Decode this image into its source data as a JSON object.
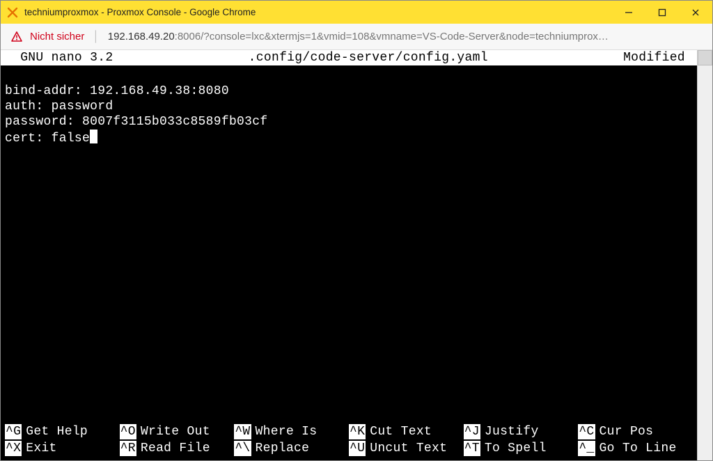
{
  "window": {
    "title": "techniumproxmox - Proxmox Console - Google Chrome"
  },
  "addrbar": {
    "not_secure_label": "Nicht sicher",
    "url_host": "192.168.49.20",
    "url_port": ":8006",
    "url_query": "/?console=lxc&xtermjs=1&vmid=108&vmname=VS-Code-Server&node=techniumprox…"
  },
  "nano": {
    "version": "  GNU nano 3.2",
    "filepath": ".config/code-server/config.yaml",
    "status": "Modified "
  },
  "file_lines": [
    "",
    "bind-addr: 192.168.49.38:8080",
    "auth: password",
    "password: 8007f3115b033c8589fb03cf",
    "cert: false"
  ],
  "shortcuts": [
    {
      "key": "^G",
      "label": "Get Help"
    },
    {
      "key": "^O",
      "label": "Write Out"
    },
    {
      "key": "^W",
      "label": "Where Is"
    },
    {
      "key": "^K",
      "label": "Cut Text"
    },
    {
      "key": "^J",
      "label": "Justify"
    },
    {
      "key": "^C",
      "label": "Cur Pos"
    },
    {
      "key": "^X",
      "label": "Exit"
    },
    {
      "key": "^R",
      "label": "Read File"
    },
    {
      "key": "^\\",
      "label": "Replace"
    },
    {
      "key": "^U",
      "label": "Uncut Text"
    },
    {
      "key": "^T",
      "label": "To Spell"
    },
    {
      "key": "^_",
      "label": "Go To Line"
    }
  ]
}
